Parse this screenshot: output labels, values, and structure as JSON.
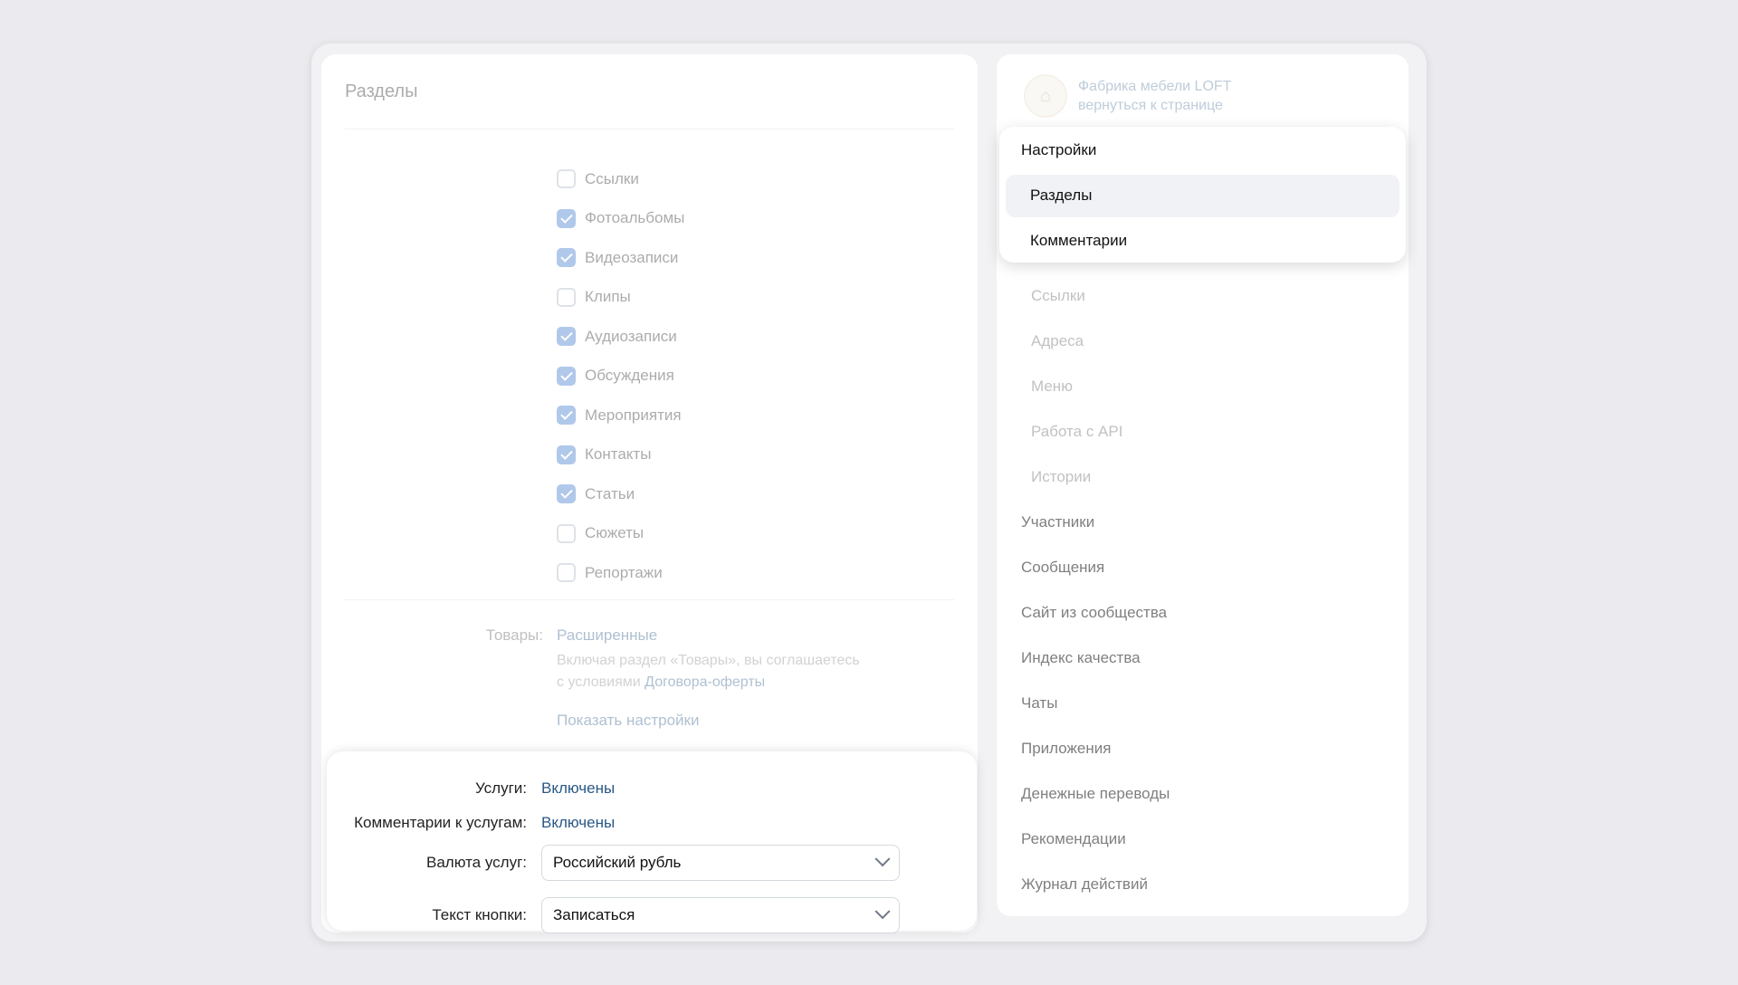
{
  "left": {
    "title": "Разделы",
    "checkboxes": [
      {
        "label": "Ссылки",
        "checked": false
      },
      {
        "label": "Фотоальбомы",
        "checked": true
      },
      {
        "label": "Видеозаписи",
        "checked": true
      },
      {
        "label": "Клипы",
        "checked": false
      },
      {
        "label": "Аудиозаписи",
        "checked": true
      },
      {
        "label": "Обсуждения",
        "checked": true
      },
      {
        "label": "Мероприятия",
        "checked": true
      },
      {
        "label": "Контакты",
        "checked": true
      },
      {
        "label": "Статьи",
        "checked": true
      },
      {
        "label": "Сюжеты",
        "checked": false
      },
      {
        "label": "Репортажи",
        "checked": false
      }
    ],
    "goods_label": "Товары:",
    "goods_value": "Расширенные",
    "goods_note_1": "Включая раздел «Товары», вы соглашаетесь",
    "goods_note_2": "с условиями ",
    "goods_note_link": "Договора-оферты",
    "show_settings": "Показать настройки"
  },
  "services": {
    "services_label": "Услуги:",
    "services_value": "Включены",
    "comments_label": "Комментарии к услугам:",
    "comments_value": "Включены",
    "currency_label": "Валюта услуг:",
    "currency_value": "Российский рубль",
    "button_label": "Текст кнопки:",
    "button_value": "Записаться"
  },
  "right": {
    "group_name": "Фабрика мебели LOFT",
    "back_link": "вернуться к странице",
    "dropdown": {
      "header": "Настройки",
      "items": [
        "Разделы",
        "Комментарии"
      ]
    },
    "sub_items": [
      "Ссылки",
      "Адреса",
      "Меню",
      "Работа с API",
      "Истории"
    ],
    "main_items": [
      "Участники",
      "Сообщения",
      "Сайт из сообщества",
      "Индекс качества",
      "Чаты",
      "Приложения",
      "Денежные переводы",
      "Рекомендации",
      "Журнал действий"
    ]
  }
}
